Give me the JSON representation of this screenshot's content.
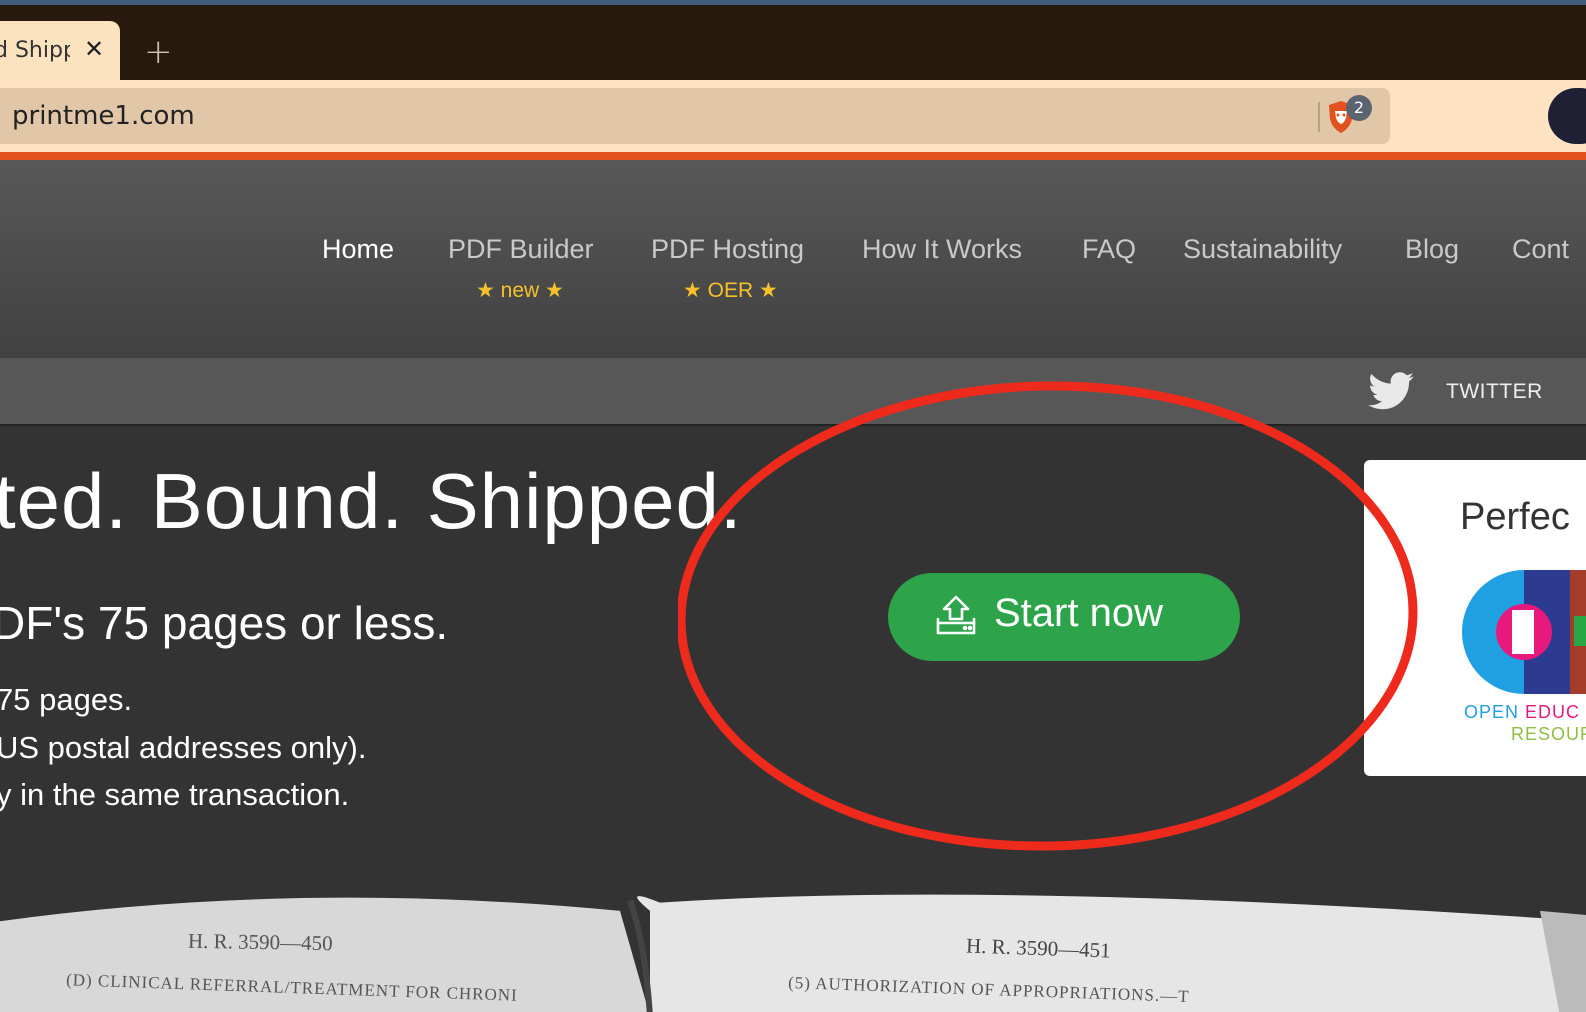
{
  "browser": {
    "tab_title": "d Shipp",
    "tab_close": "✕",
    "new_tab": "+",
    "url": "printme1.com",
    "shield_count": "2"
  },
  "nav": {
    "items": [
      {
        "label": "Home"
      },
      {
        "label": "PDF Builder",
        "sub": "new"
      },
      {
        "label": "PDF Hosting",
        "sub": "OER"
      },
      {
        "label": "How It Works"
      },
      {
        "label": "FAQ"
      },
      {
        "label": "Sustainability"
      },
      {
        "label": "Blog"
      },
      {
        "label": "Cont"
      }
    ],
    "star_glyph": "★"
  },
  "social": {
    "twitter_label": "TWITTER"
  },
  "hero": {
    "title": "ted. Bound. Shipped.",
    "subtitle": "DF's 75 pages or less.",
    "lines": [
      "75 pages.",
      "US postal addresses only).",
      "y in the same transaction."
    ],
    "cta_label": "Start now"
  },
  "oer_card": {
    "title": "Perfec",
    "line1_a": "OPEN ",
    "line1_b": "EDUC",
    "line2": "RESOUR"
  },
  "book": {
    "left_header": "H. R. 3590—450",
    "right_header": "H. R. 3590—451",
    "left_text": "(D) CLINICAL REFERRAL/TREATMENT FOR CHRONI",
    "right_text": "(5) AUTHORIZATION OF APPROPRIATIONS.—T"
  },
  "colors": {
    "accent_bar": "#e2521f",
    "cta_green": "#2ea44a",
    "star_yellow": "#f6c12a",
    "annotation_red": "#ee2a1c"
  }
}
